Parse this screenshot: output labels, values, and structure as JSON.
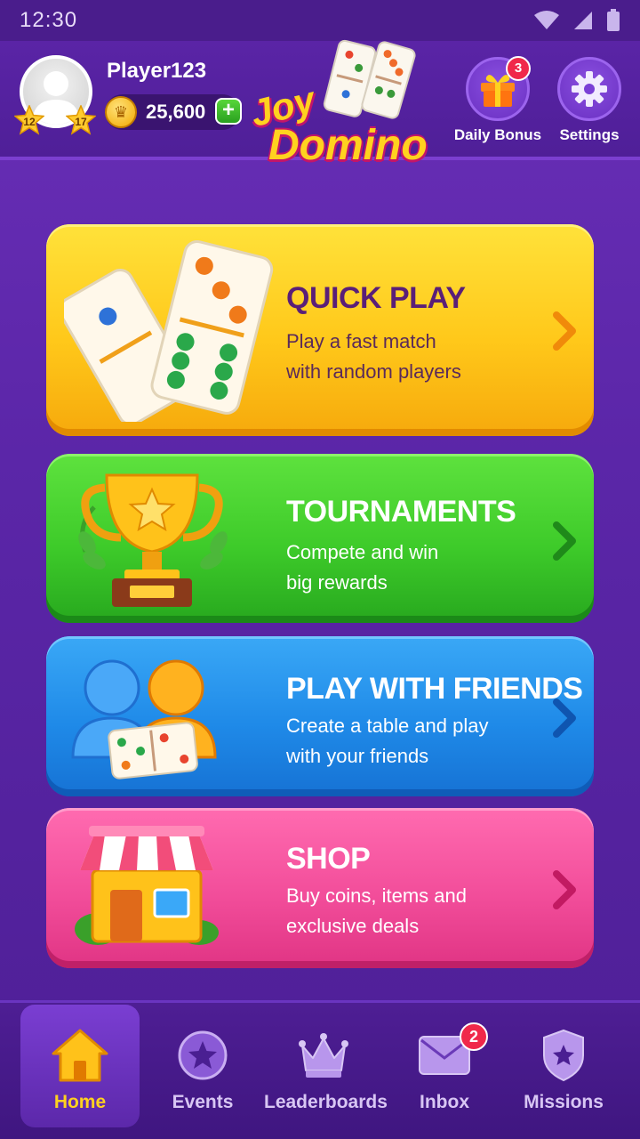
{
  "status_bar": {
    "time": "12:30"
  },
  "header": {
    "player_name": "Player123",
    "level_left": "12",
    "level_right": "17",
    "coins": "25,600",
    "logo_line1": "Joy",
    "logo_line2": "Domino",
    "daily_bonus": {
      "label": "Daily Bonus",
      "badge": "3"
    },
    "settings": {
      "label": "Settings"
    }
  },
  "cards": {
    "quick_play": {
      "title": "QUICK PLAY",
      "desc1": "Play a fast match",
      "desc2": "with random players"
    },
    "tournaments": {
      "title": "TOURNAMENTS",
      "desc1": "Compete and win",
      "desc2": "big rewards"
    },
    "friends": {
      "title": "PLAY WITH FRIENDS",
      "desc1": "Create a table and play",
      "desc2": "with your friends"
    },
    "shop": {
      "title": "SHOP",
      "desc1": "Buy coins, items and",
      "desc2": "exclusive deals"
    }
  },
  "nav": {
    "home": "Home",
    "events": "Events",
    "leaderboards": "Leaderboards",
    "inbox": "Inbox",
    "inbox_badge": "2",
    "missions": "Missions"
  },
  "colors": {
    "background": "#5b26a8",
    "quick_play": "#ffc81a",
    "tournaments": "#3ecb2a",
    "friends": "#1f8ae8",
    "shop": "#f24d9a",
    "accent_title": "#5a1f78",
    "active_nav": "#ffd21f"
  },
  "icons": [
    "wifi-icon",
    "signal-icon",
    "battery-icon",
    "gift-icon",
    "gear-icon",
    "home-icon",
    "star-icon",
    "crown-icon",
    "mail-icon",
    "shield-icon",
    "chevron-right-icon",
    "coin-icon",
    "plus-icon"
  ]
}
